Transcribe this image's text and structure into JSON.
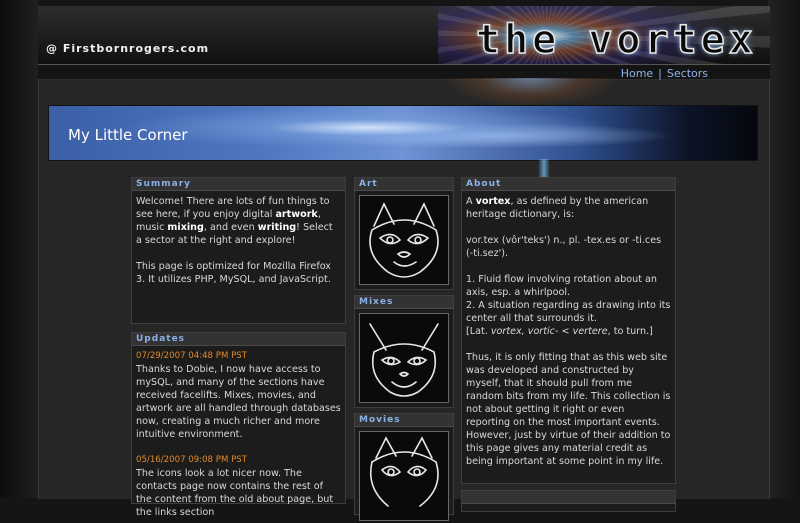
{
  "site": {
    "name": "@ Firstbornrogers.com",
    "logo": "the vortex"
  },
  "nav": {
    "home": "Home",
    "sep": "|",
    "sectors": "Sectors"
  },
  "banner": {
    "title": "My Little Corner"
  },
  "summary": {
    "header": "Summary",
    "p1": [
      "Welcome! There are lots of fun things to see here, if you enjoy digital ",
      "artwork",
      ", music ",
      "mixing",
      ", and even ",
      "writing",
      "! Select a sector at the right and explore!"
    ],
    "p2": "This page is optimized for Mozilla Firefox 3. It utilizes PHP, MySQL, and JavaScript."
  },
  "updates": {
    "header": "Updates",
    "entries": [
      {
        "date": "07/29/2007 04:48 PM PST",
        "text": "Thanks to Dobie, I now have access to mySQL, and many of the sections have received facelifts. Mixes, movies, and artwork are all handled through databases now, creating a much richer and more intuitive environment."
      },
      {
        "date": "05/16/2007 09:08 PM PST",
        "text": "The icons look a lot nicer now. The contacts page now contains the rest of the content from the old about page, but the links section"
      }
    ]
  },
  "sectors": [
    {
      "header": "Art"
    },
    {
      "header": "Mixes"
    },
    {
      "header": "Movies"
    }
  ],
  "about": {
    "header": "About",
    "intro": [
      "A ",
      "vortex",
      ", as defined by the american heritage dictionary, is:"
    ],
    "pron": "vor.tex (vôr'teks') n., pl. -tex.es or -ti.ces (-ti.sez').",
    "def1": "1. Fluid flow involving rotation about an axis, esp. a whirlpool.",
    "def2": "2. A situation regarding as drawing into its center all that surrounds it.",
    "etym": [
      "[Lat. ",
      "vortex, vortic-",
      " < ",
      "vertere",
      ", to turn.]"
    ],
    "closing": "Thus, it is only fitting that as this web site was developed and constructed by myself, that it should pull from me random bits from my life. This collection is not about getting it right or even reporting on the most important events. However, just by virtue of their addition to this page gives any material credit as being important at some point in my life."
  },
  "colors": {
    "accent": "#8ab0e6",
    "date": "#e08a2a",
    "panel": "#1c1c1c"
  }
}
